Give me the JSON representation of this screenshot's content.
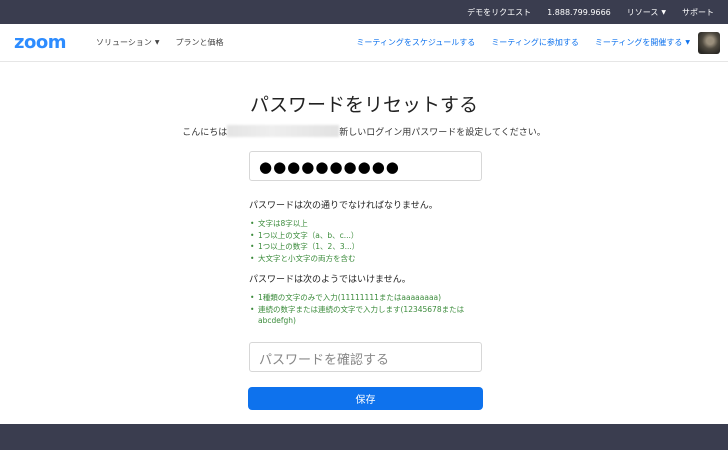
{
  "topbar": {
    "demo_label": "デモをリクエスト",
    "phone": "1.888.799.9666",
    "resources_label": "リソース",
    "support_label": "サポート"
  },
  "navbar": {
    "logo_text": "zoom",
    "solutions_label": "ソリューション",
    "plans_label": "プランと価格",
    "schedule_label": "ミーティングをスケジュールする",
    "join_label": "ミーティングに参加する",
    "host_label": "ミーティングを開催する"
  },
  "form": {
    "title": "パスワードをリセットする",
    "subtitle_prefix": "こんにちは",
    "subtitle_suffix": "新しいログイン用パスワードを設定してください。",
    "password_value": "●●●●●●●●●●",
    "must_heading": "パスワードは次の通りでなければなりません。",
    "must_rules": [
      "文字は8字以上",
      "1つ以上の文字（a、b、c...）",
      "1つ以上の数字（1、2、3...）",
      "大文字と小文字の両方を含む"
    ],
    "mustnot_heading": "パスワードは次のようではいけません。",
    "mustnot_rules": [
      "1種類の文字のみで入力(11111111またはaaaaaaaa)",
      "連続の数字または連続の文字で入力します(12345678またはabcdefgh)"
    ],
    "confirm_placeholder": "パスワードを確認する",
    "save_label": "保存"
  },
  "colors": {
    "brand_blue": "#2d8cff",
    "link_blue": "#0e72ed",
    "header_dark": "#3a3d4f",
    "rule_green": "#3c8c3c"
  }
}
